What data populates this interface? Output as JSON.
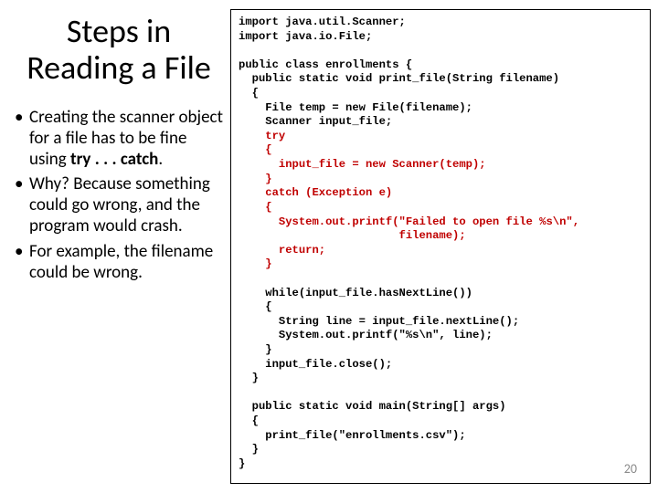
{
  "title": "Steps in Reading a File",
  "bullets": [
    {
      "pre": "Creating the scanner object for a file has to be fine using\n",
      "bold": "try . . . catch",
      "post": "."
    },
    {
      "pre": "Why? Because something could go wrong, and the program would crash.",
      "bold": "",
      "post": ""
    },
    {
      "pre": "For example, the filename could be wrong.",
      "bold": "",
      "post": ""
    }
  ],
  "code": {
    "l01": "import java.util.Scanner;",
    "l02": "import java.io.File;",
    "l03": "",
    "l04": "public class enrollments {",
    "l05": "  public static void print_file(String filename)",
    "l06": "  {",
    "l07": "    File temp = new File(filename);",
    "l08": "    Scanner input_file;",
    "l09a": "    ",
    "l09b": "try",
    "l10a": "    ",
    "l10b": "{",
    "l11a": "      ",
    "l11b": "input_file = new Scanner(temp);",
    "l12a": "    ",
    "l12b": "}",
    "l13a": "    ",
    "l13b": "catch (Exception e)",
    "l14a": "    ",
    "l14b": "{",
    "l15a": "      ",
    "l15b": "System.out.printf(\"Failed to open file %s\\n\",",
    "l16a": "                        ",
    "l16b": "filename);",
    "l17a": "      ",
    "l17b": "return;",
    "l18a": "    ",
    "l18b": "}",
    "l19": "",
    "l20": "    while(input_file.hasNextLine())",
    "l21": "    {",
    "l22": "      String line = input_file.nextLine();",
    "l23": "      System.out.printf(\"%s\\n\", line);",
    "l24": "    }",
    "l25": "    input_file.close();",
    "l26": "  }",
    "l27": "",
    "l28": "  public static void main(String[] args)",
    "l29": "  {",
    "l30": "    print_file(\"enrollments.csv\");",
    "l31": "  }",
    "l32": "}"
  },
  "pagenum": "20"
}
